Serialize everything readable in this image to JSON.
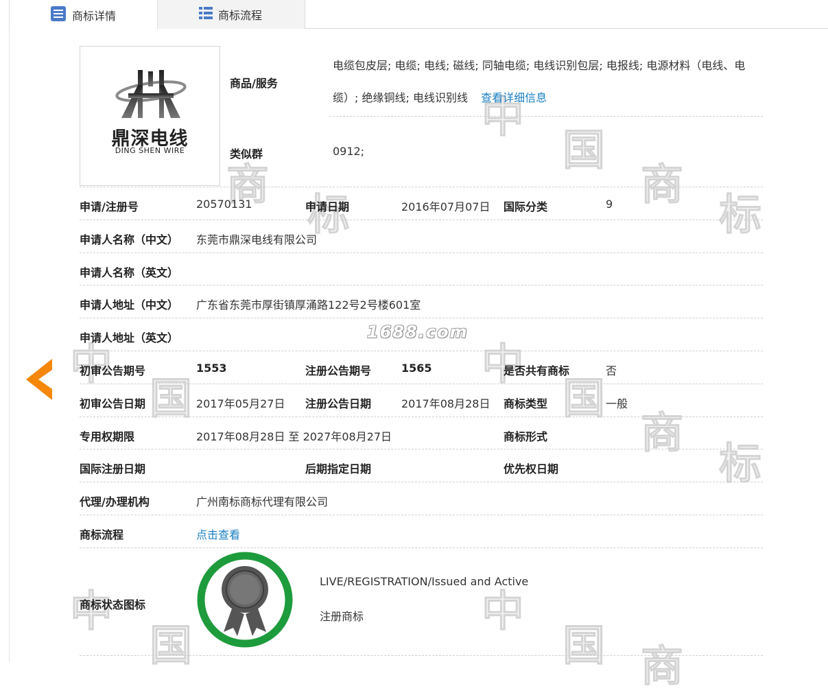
{
  "tabs": [
    {
      "label": "商标详情",
      "icon": "list-document-icon",
      "active": true
    },
    {
      "label": "商标流程",
      "icon": "list-icon",
      "active": false
    }
  ],
  "watermark": {
    "chars": [
      "中",
      "国",
      "商",
      "标"
    ]
  },
  "logo": {
    "text_cn": "鼎深电线",
    "text_en": "DING SHEN WIRE"
  },
  "goods": {
    "label": "商品/服务",
    "value": "电缆包皮层; 电缆; 电线; 磁线; 同轴电缆; 电线识别包层; 电报线; 电源材料（电线、电缆）; 绝缘铜线; 电线识别线",
    "link": "查看详细信息"
  },
  "similar_group": {
    "label": "类似群",
    "value": "0912;"
  },
  "fields": {
    "reg_no": {
      "label": "申请/注册号",
      "value": "20570131"
    },
    "apply_date": {
      "label": "申请日期",
      "value": "2016年07月07日"
    },
    "intl_class": {
      "label": "国际分类",
      "value": "9"
    },
    "applicant_cn": {
      "label": "申请人名称（中文）",
      "value": "东莞市鼎深电线有限公司"
    },
    "applicant_en": {
      "label": "申请人名称（英文）",
      "value": ""
    },
    "address_cn": {
      "label": "申请人地址（中文）",
      "value": "广东省东莞市厚街镇厚涌路122号2号楼601室"
    },
    "address_en": {
      "label": "申请人地址（英文）",
      "value": ""
    },
    "prelim_issue": {
      "label": "初审公告期号",
      "value": "1553"
    },
    "reg_issue": {
      "label": "注册公告期号",
      "value": "1565"
    },
    "shared": {
      "label": "是否共有商标",
      "value": "否"
    },
    "prelim_date": {
      "label": "初审公告日期",
      "value": "2017年05月27日"
    },
    "reg_date": {
      "label": "注册公告日期",
      "value": "2017年08月28日"
    },
    "tm_type": {
      "label": "商标类型",
      "value": "一般"
    },
    "exclusive_period": {
      "label": "专用权期限",
      "value": "2017年08月28日 至 2027年08月27日"
    },
    "tm_form": {
      "label": "商标形式",
      "value": ""
    },
    "intl_reg_date": {
      "label": "国际注册日期",
      "value": ""
    },
    "later_date": {
      "label": "后期指定日期",
      "value": ""
    },
    "priority_date": {
      "label": "优先权日期",
      "value": ""
    },
    "agent": {
      "label": "代理/办理机构",
      "value": "广州南标商标代理有限公司"
    },
    "flow": {
      "label": "商标流程",
      "link": "点击查看"
    }
  },
  "status": {
    "label": "商标状态图标",
    "line1": "LIVE/REGISTRATION/Issued and Active",
    "line2": "注册商标",
    "ring_color": "#1e9b3c",
    "medal_color": "#555555"
  },
  "site_mark": "1688.com",
  "colors": {
    "link": "#1a7fc1",
    "arrow": "#f5870a"
  }
}
